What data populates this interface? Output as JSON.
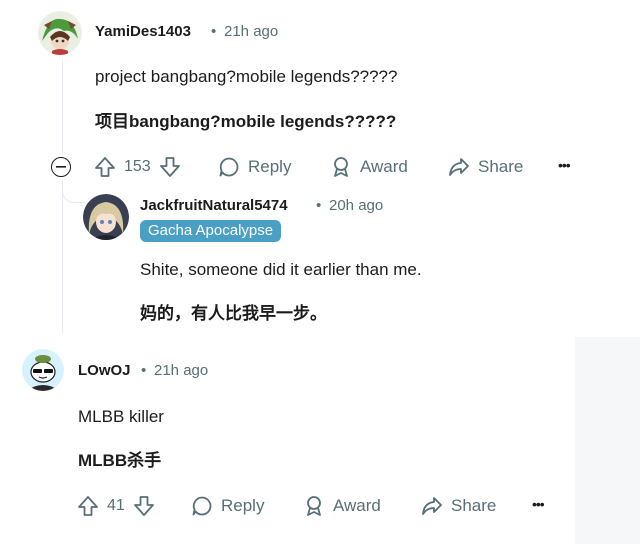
{
  "comments": [
    {
      "username": "YamiDes1403",
      "time": "21h ago",
      "text": "project bangbang?mobile legends?????",
      "translation": "项目bangbang?mobile legends?????",
      "votes": "153",
      "actions": {
        "reply": "Reply",
        "award": "Award",
        "share": "Share",
        "more": "•••"
      }
    },
    {
      "username": "JackfruitNatural5474",
      "time": "20h ago",
      "flair": "Gacha Apocalypse",
      "text": "Shite, someone did it earlier than me.",
      "translation": "妈的，有人比我早一步。"
    },
    {
      "username": "LOwOJ",
      "time": "21h ago",
      "text": "MLBB killer",
      "translation": "MLBB杀手",
      "votes": "41",
      "actions": {
        "reply": "Reply",
        "award": "Award",
        "share": "Share",
        "more": "•••"
      }
    }
  ],
  "separator": "•",
  "collapse_symbol": "−",
  "colors": {
    "meta": "#576f76",
    "flair": "#4a9fc4",
    "thread_line": "#e5ebee"
  },
  "icons": [
    "upvote-icon",
    "downvote-icon",
    "reply-bubble-icon",
    "award-icon",
    "share-icon",
    "collapse-icon"
  ]
}
